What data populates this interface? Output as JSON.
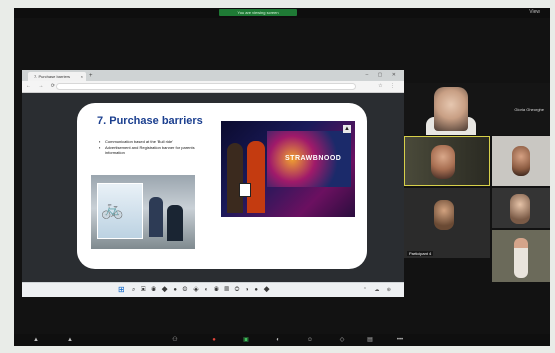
{
  "meeting": {
    "top_indicator": "You are viewing screen",
    "view_label": "View"
  },
  "browser": {
    "tab_title": "7. Purchase barriers",
    "tab_close": "×",
    "new_tab": "+",
    "window_controls": "– ▢ ✕",
    "nav_buttons": "← → ⟳",
    "url": "",
    "toolbar_icons": "☆ ⋮"
  },
  "slide": {
    "title": "7. Purchase barriers",
    "bullets": [
      "Communication based at the 'Bull ride'",
      "Advertisement and Registration banner for parents information"
    ],
    "banner_text": "STRAWBNOOD"
  },
  "taskbar": {
    "start": "⊞",
    "icons": "⌕ ▣ ◉ ◆ ● ◍ ◈ ◐ ◉ ▤ ◎ ◑ ● ◆",
    "tray": "⌃ ☁ ⊕"
  },
  "participants": [
    {
      "id": "host",
      "label": "Gloria Gheorghe"
    },
    {
      "id": "speaker",
      "label": ""
    },
    {
      "id": "r1",
      "label": ""
    },
    {
      "id": "l2",
      "label": "Participant 4"
    },
    {
      "id": "r2",
      "label": ""
    },
    {
      "id": "r3",
      "label": ""
    }
  ],
  "controls": [
    {
      "name": "mute-icon",
      "glyph": "▲",
      "color": "default"
    },
    {
      "name": "video-icon",
      "glyph": "▲",
      "color": "default"
    },
    {
      "name": "participants-icon",
      "glyph": "⚇",
      "color": "default"
    },
    {
      "name": "chat-icon",
      "glyph": "●",
      "color": "red"
    },
    {
      "name": "share-icon",
      "glyph": "▣",
      "color": "green"
    },
    {
      "name": "record-icon",
      "glyph": "◐",
      "color": "default"
    },
    {
      "name": "reactions-icon",
      "glyph": "☺",
      "color": "default"
    },
    {
      "name": "apps-icon",
      "glyph": "◇",
      "color": "default"
    },
    {
      "name": "whiteboard-icon",
      "glyph": "▤",
      "color": "default"
    },
    {
      "name": "more-icon",
      "glyph": "•••",
      "color": "default"
    }
  ]
}
